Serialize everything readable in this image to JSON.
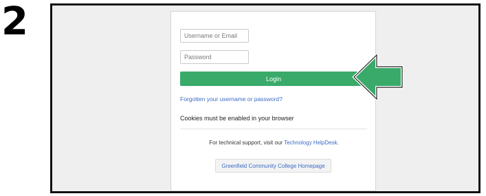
{
  "step_number": "2",
  "login_form": {
    "username_placeholder": "Username or Email",
    "password_placeholder": "Password",
    "login_label": "Login",
    "forgot_link": "Forgotten your username or password?",
    "cookies_notice": "Cookies must be enabled in your browser",
    "support_text": "For technical support, visit our ",
    "support_link": "Technology HelpDesk",
    "support_suffix": ".",
    "homepage_button": "Greenfield Community College Homepage"
  },
  "callout": {
    "icon": "arrow-left-icon",
    "color": "#3aaa6a"
  },
  "colors": {
    "primary_button": "#3aaa6a",
    "link": "#3b6bc4",
    "frame_background": "#efefef"
  }
}
